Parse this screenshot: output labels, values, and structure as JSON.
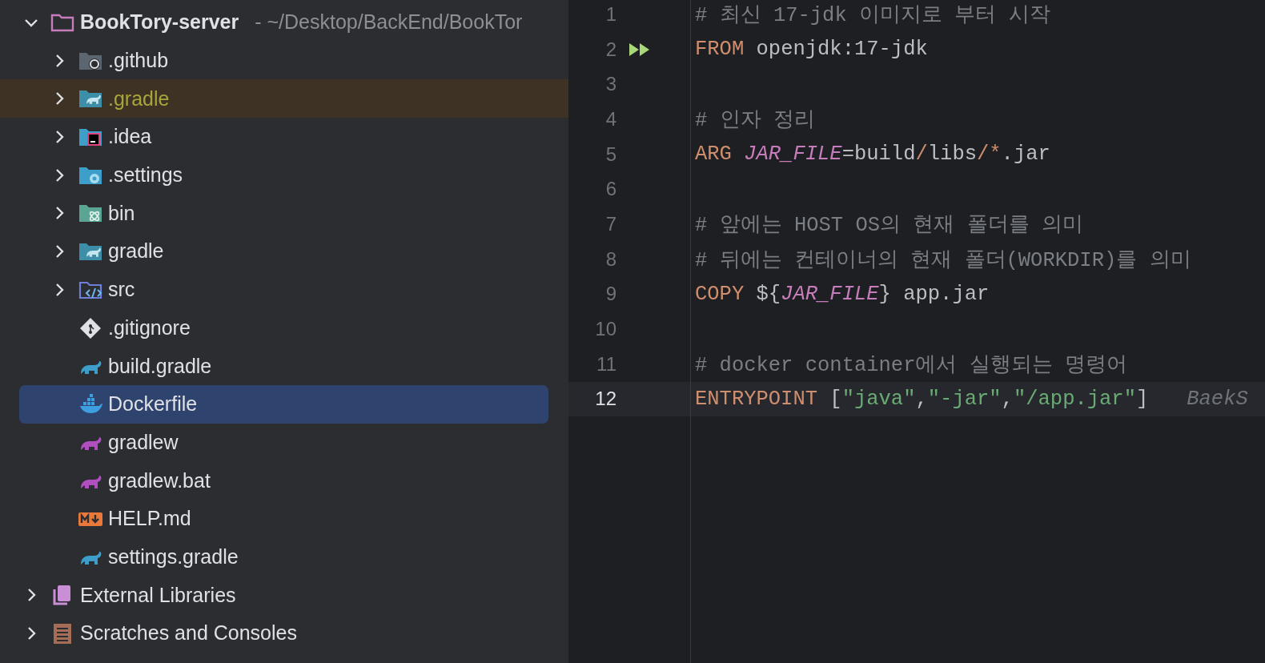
{
  "project_tree": {
    "root": {
      "label": "BookTory-server",
      "path": "- ~/Desktop/BackEnd/BookTor",
      "kind": "module",
      "expanded": true,
      "selected": false,
      "ignored": false,
      "children": [
        {
          "label": ".github",
          "kind": "github",
          "expanded": false,
          "selected": false,
          "ignored": false
        },
        {
          "label": ".gradle",
          "kind": "gradledir",
          "expanded": false,
          "selected": false,
          "ignored": true
        },
        {
          "label": ".idea",
          "kind": "idea",
          "expanded": false,
          "selected": false,
          "ignored": false
        },
        {
          "label": ".settings",
          "kind": "settings",
          "expanded": false,
          "selected": false,
          "ignored": false
        },
        {
          "label": "bin",
          "kind": "bin",
          "expanded": false,
          "selected": false,
          "ignored": false
        },
        {
          "label": "gradle",
          "kind": "gradledir",
          "expanded": false,
          "selected": false,
          "ignored": false
        },
        {
          "label": "src",
          "kind": "source",
          "expanded": false,
          "selected": false,
          "ignored": false
        },
        {
          "label": ".gitignore",
          "kind": "gitignore",
          "selected": false,
          "ignored": false
        },
        {
          "label": "build.gradle",
          "kind": "gradle",
          "selected": false,
          "ignored": false
        },
        {
          "label": "Dockerfile",
          "kind": "docker",
          "selected": true,
          "ignored": false
        },
        {
          "label": "gradlew",
          "kind": "gradlew",
          "selected": false,
          "ignored": false
        },
        {
          "label": "gradlew.bat",
          "kind": "gradlew",
          "selected": false,
          "ignored": false
        },
        {
          "label": "HELP.md",
          "kind": "markdown",
          "selected": false,
          "ignored": false
        },
        {
          "label": "settings.gradle",
          "kind": "gradle",
          "selected": false,
          "ignored": false
        }
      ]
    },
    "others": [
      {
        "label": "External Libraries",
        "kind": "libraries",
        "expanded": false,
        "selected": false,
        "ignored": false
      },
      {
        "label": "Scratches and Consoles",
        "kind": "scratches",
        "expanded": false,
        "selected": false,
        "ignored": false
      }
    ]
  },
  "editor": {
    "lines": [
      {
        "number": "1",
        "current": false,
        "runnable": false,
        "tokens": [
          {
            "text": "# 최신 17-jdk 이미지로 부터 시작",
            "kind": "comment"
          }
        ]
      },
      {
        "number": "2",
        "current": false,
        "runnable": true,
        "tokens": [
          {
            "text": "FROM",
            "kind": "keyword"
          },
          {
            "text": " openjdk:17-jdk",
            "kind": "plain"
          }
        ]
      },
      {
        "number": "3",
        "current": false,
        "runnable": false
      },
      {
        "number": "4",
        "current": false,
        "runnable": false,
        "tokens": [
          {
            "text": "# 인자 정리",
            "kind": "comment"
          }
        ]
      },
      {
        "number": "5",
        "current": false,
        "runnable": false,
        "tokens": [
          {
            "text": "ARG ",
            "kind": "keyword"
          },
          {
            "text": "JAR_FILE",
            "kind": "variable"
          },
          {
            "text": "=build",
            "kind": "plain"
          },
          {
            "text": "/",
            "kind": "operator"
          },
          {
            "text": "libs",
            "kind": "plain"
          },
          {
            "text": "/*",
            "kind": "operator"
          },
          {
            "text": ".jar",
            "kind": "plain"
          }
        ]
      },
      {
        "number": "6",
        "current": false,
        "runnable": false
      },
      {
        "number": "7",
        "current": false,
        "runnable": false,
        "tokens": [
          {
            "text": "# 앞에는 HOST OS의 현재 폴더를 의미",
            "kind": "comment"
          }
        ]
      },
      {
        "number": "8",
        "current": false,
        "runnable": false,
        "tokens": [
          {
            "text": "# 뒤에는 컨테이너의 현재 폴더(WORKDIR)를 의미",
            "kind": "comment"
          }
        ]
      },
      {
        "number": "9",
        "current": false,
        "runnable": false,
        "tokens": [
          {
            "text": "COPY",
            "kind": "keyword"
          },
          {
            "text": " ${",
            "kind": "plain"
          },
          {
            "text": "JAR_FILE",
            "kind": "variable"
          },
          {
            "text": "} app.jar",
            "kind": "plain"
          }
        ]
      },
      {
        "number": "10",
        "current": false,
        "runnable": false
      },
      {
        "number": "11",
        "current": false,
        "runnable": false,
        "tokens": [
          {
            "text": "# docker container에서 실행되는 명령어",
            "kind": "comment"
          }
        ]
      },
      {
        "number": "12",
        "current": true,
        "runnable": false,
        "hint": "BaekS",
        "tokens": [
          {
            "text": "ENTRYPOINT",
            "kind": "keyword"
          },
          {
            "text": " [",
            "kind": "plain"
          },
          {
            "text": "\"java\"",
            "kind": "string"
          },
          {
            "text": ",",
            "kind": "plain"
          },
          {
            "text": "\"-jar\"",
            "kind": "string"
          },
          {
            "text": ",",
            "kind": "plain"
          },
          {
            "text": "\"/app.jar\"",
            "kind": "string"
          },
          {
            "text": "]",
            "kind": "plain"
          }
        ]
      }
    ]
  }
}
